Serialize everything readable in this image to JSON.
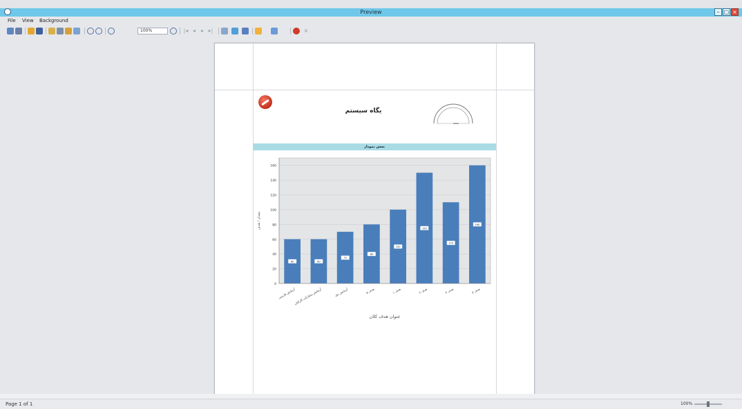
{
  "window": {
    "title": "Preview",
    "controls": {
      "minimize": "–",
      "maximize": "▢",
      "close": "×"
    }
  },
  "menu": {
    "items": [
      "File",
      "View",
      "Background"
    ]
  },
  "toolbar": {
    "zoom_value": "100%",
    "icons": [
      "open-icon",
      "save-icon",
      "print-icon",
      "export-icon",
      "zoom-in-icon",
      "zoom-out-icon",
      "first-page-icon",
      "prev-page-icon",
      "next-page-icon",
      "last-page-icon",
      "page-setup-icon",
      "watermark-icon",
      "close-icon"
    ]
  },
  "report": {
    "title": "یگاه سیستم",
    "section_header": "بخش نمودار"
  },
  "chart_data": {
    "type": "bar",
    "categories": [
      "آزمایش فارسی",
      "آزمایش مشارکت کارکنان",
      "آزمایش جلد",
      "هدف ۵",
      "هدف ۱",
      "هدف ۲",
      "هدف ۴",
      "هدف ۳"
    ],
    "values": [
      60,
      60,
      70,
      80,
      100,
      150,
      110,
      160
    ],
    "xlabel": "عنوان هدف کلان",
    "ylabel": "مقدار / هدف",
    "ylim": [
      0,
      170
    ],
    "yticks": [
      0,
      20,
      40,
      60,
      80,
      100,
      120,
      140,
      160
    ],
    "bar_color": "#4a7ebb",
    "grid": true
  },
  "status": {
    "page": "Page 1 of 1",
    "zoom": "100%"
  }
}
